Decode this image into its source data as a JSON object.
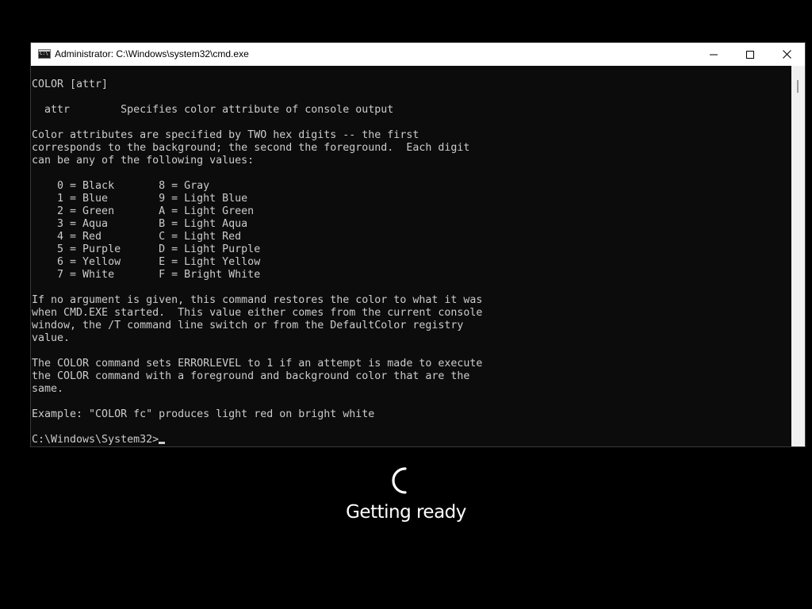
{
  "window": {
    "title": "Administrator: C:\\Windows\\system32\\cmd.exe",
    "icon": "cmd-icon",
    "icon_text": "C:\\"
  },
  "controls": {
    "minimize": "minimize-icon",
    "maximize": "maximize-icon",
    "close": "close-icon"
  },
  "console": {
    "lines": [
      "COLOR [attr]",
      "",
      "  attr        Specifies color attribute of console output",
      "",
      "Color attributes are specified by TWO hex digits -- the first",
      "corresponds to the background; the second the foreground.  Each digit",
      "can be any of the following values:",
      "",
      "    0 = Black       8 = Gray",
      "    1 = Blue        9 = Light Blue",
      "    2 = Green       A = Light Green",
      "    3 = Aqua        B = Light Aqua",
      "    4 = Red         C = Light Red",
      "    5 = Purple      D = Light Purple",
      "    6 = Yellow      E = Light Yellow",
      "    7 = White       F = Bright White",
      "",
      "If no argument is given, this command restores the color to what it was",
      "when CMD.EXE started.  This value either comes from the current console",
      "window, the /T command line switch or from the DefaultColor registry",
      "value.",
      "",
      "The COLOR command sets ERRORLEVEL to 1 if an attempt is made to execute",
      "the COLOR command with a foreground and background color that are the",
      "same.",
      "",
      "Example: \"COLOR fc\" produces light red on bright white",
      ""
    ],
    "prompt": "C:\\Windows\\System32>"
  },
  "setup": {
    "status": "Getting ready",
    "spinner": "loading-spinner-icon"
  },
  "colors": {
    "console_bg": "#0c0c0c",
    "console_text": "#cccccc",
    "titlebar_bg": "#ffffff",
    "screen_bg": "#000000",
    "status_text": "#ffffff"
  }
}
